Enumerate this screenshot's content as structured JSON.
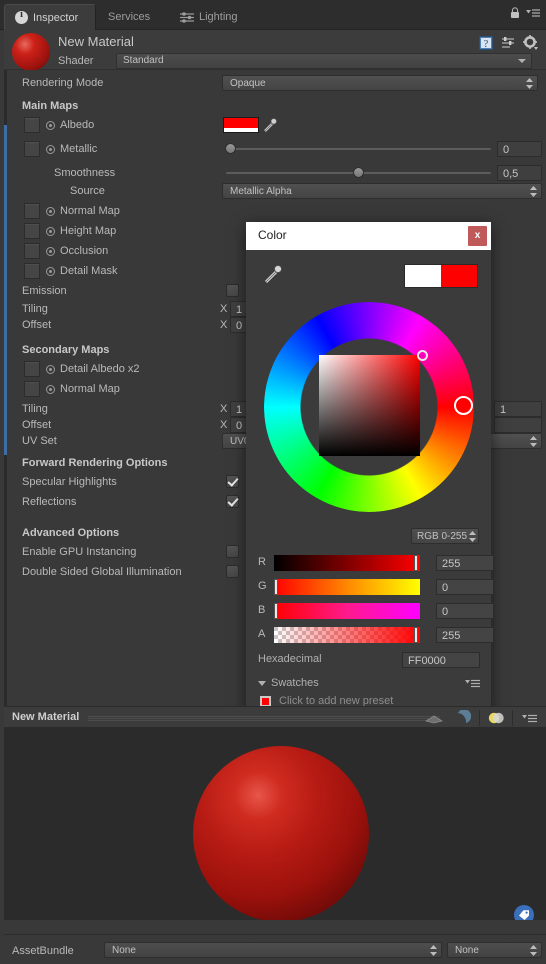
{
  "tabs": [
    {
      "label": "Inspector",
      "icon": "info-icon",
      "active": true
    },
    {
      "label": "Services",
      "icon": "",
      "active": false
    },
    {
      "label": "Lighting",
      "icon": "sliders-icon",
      "active": false
    }
  ],
  "header": {
    "material_name": "New Material",
    "shader_label": "Shader",
    "shader_value": "Standard",
    "icons": [
      "help-icon",
      "preset-icon",
      "gear-icon"
    ]
  },
  "properties": {
    "rendering_mode_label": "Rendering Mode",
    "rendering_mode_value": "Opaque",
    "main_maps_header": "Main Maps",
    "albedo_label": "Albedo",
    "albedo_color": "#FF0000",
    "metallic_label": "Metallic",
    "metallic_value": "0",
    "smoothness_label": "Smoothness",
    "smoothness_value": "0,5",
    "source_label": "Source",
    "source_value": "Metallic Alpha",
    "normal_map_label": "Normal Map",
    "height_map_label": "Height Map",
    "occlusion_label": "Occlusion",
    "detail_mask_label": "Detail Mask",
    "emission_label": "Emission",
    "tiling_label": "Tiling",
    "tiling_x_axis": "X",
    "tiling_x_value": "1",
    "offset_label": "Offset",
    "offset_x_axis": "X",
    "offset_x_value": "0",
    "secondary_maps_header": "Secondary Maps",
    "detail_albedo_label": "Detail Albedo x2",
    "sec_normal_map_label": "Normal Map",
    "sec_tiling_label": "Tiling",
    "sec_tiling_x_axis": "X",
    "sec_tiling_x_value": "1",
    "sec_tiling_y_value": "1",
    "sec_offset_label": "Offset",
    "sec_offset_x_axis": "X",
    "sec_offset_x_value": "0",
    "uv_set_label": "UV Set",
    "uv_set_value": "UV0",
    "forward_rendering_header": "Forward Rendering Options",
    "specular_highlights_label": "Specular Highlights",
    "specular_highlights_checked": true,
    "reflections_label": "Reflections",
    "reflections_checked": true,
    "advanced_options_header": "Advanced Options",
    "gpu_instancing_label": "Enable GPU Instancing",
    "gpu_instancing_checked": false,
    "double_sided_gi_label": "Double Sided Global Illumination",
    "double_sided_gi_checked": false
  },
  "color_picker": {
    "title": "Color",
    "close_label": "x",
    "mode_value": "RGB 0-255",
    "old_color": "#FFFFFF",
    "new_color": "#FF0000",
    "channels": [
      {
        "name": "R",
        "value": "255"
      },
      {
        "name": "G",
        "value": "0"
      },
      {
        "name": "B",
        "value": "0"
      },
      {
        "name": "A",
        "value": "255"
      }
    ],
    "hex_label": "Hexadecimal",
    "hex_value": "FF0000",
    "swatches_label": "Swatches",
    "preset_hint": "Click to add new preset",
    "preset_color": "#FF0000"
  },
  "preview": {
    "title": "New Material",
    "icons": [
      "plane-icon",
      "sphere-icon",
      "lighting-toggle-icon",
      "preview-menu-icon"
    ]
  },
  "asset_bundle": {
    "label": "AssetBundle",
    "name_value": "None",
    "variant_value": "None"
  }
}
